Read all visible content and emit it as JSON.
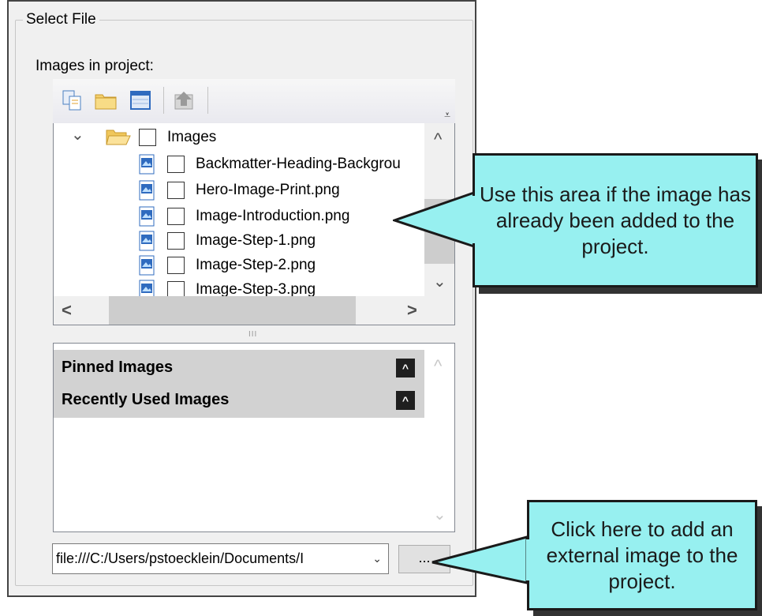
{
  "dialog": {
    "group_title": "Select File",
    "images_label": "Images in project:"
  },
  "toolbar": {
    "buttons": [
      {
        "icon": "copy-icon"
      },
      {
        "icon": "folder-icon"
      },
      {
        "icon": "grid-view-icon"
      },
      {
        "icon": "upload-icon",
        "disabled": true
      }
    ],
    "overflow_icon": "overflow-chevron-icon",
    "overflow_glyph": "⩡"
  },
  "tree": {
    "root": {
      "label": "Images",
      "expanded": true,
      "expand_glyph": "⌄"
    },
    "files": [
      {
        "label": "Backmatter-Heading-Backgrou"
      },
      {
        "label": "Hero-Image-Print.png"
      },
      {
        "label": "Image-Introduction.png"
      },
      {
        "label": "Image-Step-1.png"
      },
      {
        "label": "Image-Step-2.png"
      },
      {
        "label": "Image-Step-3.png"
      }
    ],
    "scroll_glyphs": {
      "up": "^",
      "down": "⌄",
      "left": "<",
      "right": ">"
    },
    "splitter_grip": "III"
  },
  "lower_list": {
    "sections": [
      {
        "label": "Pinned Images",
        "collapse_glyph": "^"
      },
      {
        "label": "Recently Used Images",
        "collapse_glyph": "^"
      }
    ],
    "scroll_glyphs": {
      "up": "^",
      "down": "⌄"
    }
  },
  "path_field": {
    "value": "file:///C:/Users/pstoecklein/Documents/I",
    "dropdown_glyph": "⌄"
  },
  "browse_button": {
    "label": "..."
  },
  "callouts": [
    {
      "text": "Use this area if the image has already been added to the project."
    },
    {
      "text": "Click here to add an external image to the project."
    }
  ],
  "colors": {
    "callout_fill": "#97f0f0",
    "callout_border": "#1a1a1a",
    "header_gray": "#d2d2d2",
    "panel_bg": "#f0f0f0"
  }
}
